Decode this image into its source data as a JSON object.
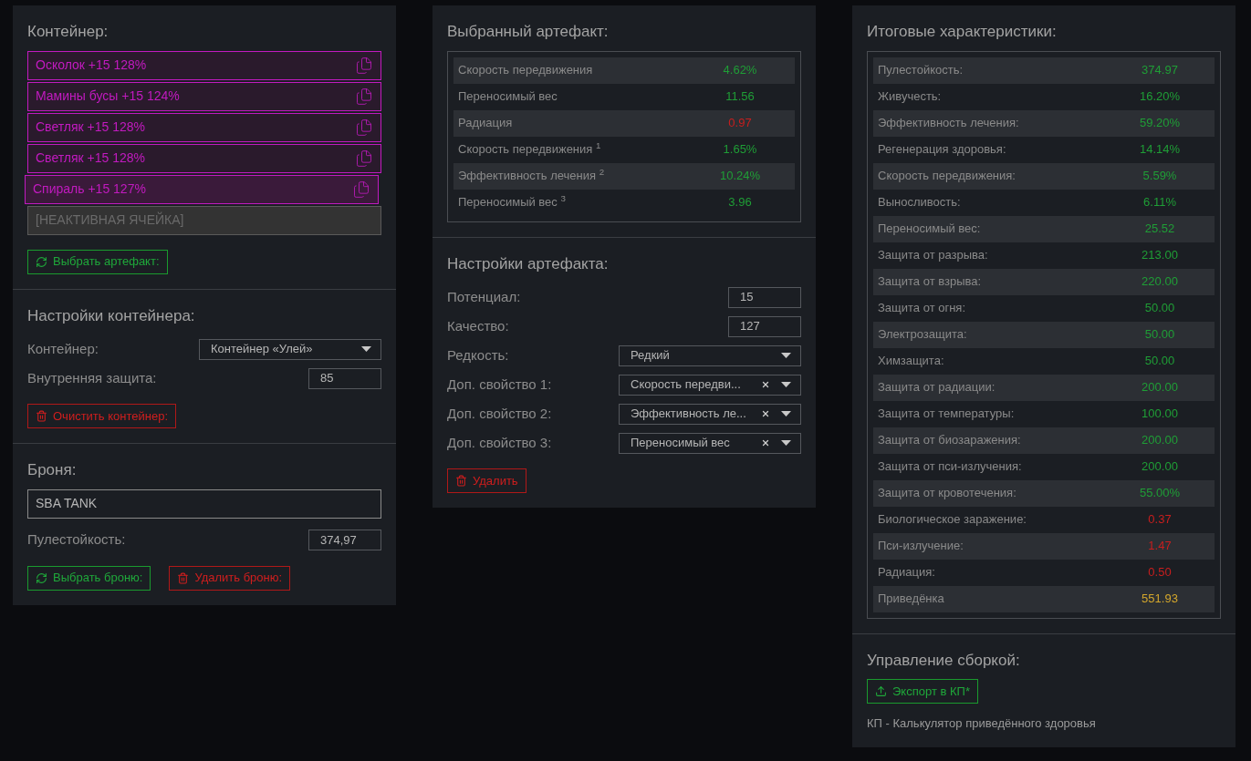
{
  "container": {
    "title": "Контейнер:",
    "slots": [
      {
        "kind": "artifact",
        "label": "Осколок +15 128%",
        "selected": false
      },
      {
        "kind": "artifact",
        "label": "Мамины бусы +15 124%",
        "selected": false
      },
      {
        "kind": "artifact",
        "label": "Светляк +15 128%",
        "selected": false
      },
      {
        "kind": "artifact",
        "label": "Светляк +15 128%",
        "selected": false
      },
      {
        "kind": "artifact",
        "label": "Спираль +15 127%",
        "selected": true
      },
      {
        "kind": "inactive",
        "label": "[НЕАКТИВНАЯ ЯЧЕЙКА]",
        "selected": false
      }
    ],
    "buttons": [
      {
        "kind": "pick",
        "label": "Выбрать артефакт:"
      }
    ]
  },
  "container_settings": {
    "title": "Настройки контейнера:",
    "fields": [
      {
        "kind": "select",
        "label": "Контейнер:",
        "value": "Контейнер «Улей»",
        "clearable": false
      },
      {
        "kind": "number",
        "label": "Внутренняя защита:",
        "value": "85"
      }
    ],
    "buttons": [
      {
        "kind": "delete",
        "label": "Очистить контейнер:"
      }
    ]
  },
  "armor": {
    "title": "Броня:",
    "name_field": {
      "value": "SBA TANK"
    },
    "fields": [
      {
        "kind": "number",
        "label": "Пулестойкость:",
        "value": "374,97"
      }
    ],
    "buttons": [
      {
        "kind": "pick",
        "label": "Выбрать броню:"
      },
      {
        "kind": "delete",
        "label": "Удалить броню:"
      }
    ]
  },
  "selected_artifact": {
    "title": "Выбранный артефакт:",
    "stats": [
      {
        "label": "Скорость передвижения",
        "value": "4.62%",
        "color": "#1f9e36"
      },
      {
        "label": "Переносимый вес",
        "value": "11.56",
        "color": "#1f9e36"
      },
      {
        "label": "Радиация",
        "value": "0.97",
        "color": "#c81e1e"
      },
      {
        "label": "Скорость передвижения $^{1}$",
        "value": "1.65%",
        "color": "#1f9e36"
      },
      {
        "label": "Эффективность лечения $^{2}$",
        "value": "10.24%",
        "color": "#1f9e36"
      },
      {
        "label": "Переносимый вес $^{3}$",
        "value": "3.96",
        "color": "#1f9e36"
      }
    ]
  },
  "artifact_settings": {
    "title": "Настройки артефакта:",
    "fields": [
      {
        "kind": "number",
        "label": "Потенциал:",
        "value": "15"
      },
      {
        "kind": "number",
        "label": "Качество:",
        "value": "127"
      },
      {
        "kind": "select",
        "label": "Редкость:",
        "value": "Редкий",
        "clearable": false
      },
      {
        "kind": "select",
        "label": "Доп. свойство 1:",
        "value": "Скорость передви...",
        "clearable": true
      },
      {
        "kind": "select",
        "label": "Доп. свойство 2:",
        "value": "Эффективность ле...",
        "clearable": true
      },
      {
        "kind": "select",
        "label": "Доп. свойство 3:",
        "value": "Переносимый вес",
        "clearable": true
      }
    ],
    "buttons": [
      {
        "kind": "delete",
        "label": "Удалить"
      }
    ]
  },
  "totals": {
    "title": "Итоговые характеристики:",
    "stats": [
      {
        "label": "Пулестойкость:",
        "value": "374.97",
        "color": "#1f9e36"
      },
      {
        "label": "Живучесть:",
        "value": "16.20%",
        "color": "#1f9e36"
      },
      {
        "label": "Эффективность лечения:",
        "value": "59.20%",
        "color": "#1f9e36"
      },
      {
        "label": "Регенерация здоровья:",
        "value": "14.14%",
        "color": "#1f9e36"
      },
      {
        "label": "Скорость передвижения:",
        "value": "5.59%",
        "color": "#1f9e36"
      },
      {
        "label": "Выносливость:",
        "value": "6.11%",
        "color": "#1f9e36"
      },
      {
        "label": "Переносимый вес:",
        "value": "25.52",
        "color": "#1f9e36"
      },
      {
        "label": "Защита от разрыва:",
        "value": "213.00",
        "color": "#1f9e36"
      },
      {
        "label": "Защита от взрыва:",
        "value": "220.00",
        "color": "#1f9e36"
      },
      {
        "label": "Защита от огня:",
        "value": "50.00",
        "color": "#1f9e36"
      },
      {
        "label": "Электрозащита:",
        "value": "50.00",
        "color": "#1f9e36"
      },
      {
        "label": "Химзащита:",
        "value": "50.00",
        "color": "#1f9e36"
      },
      {
        "label": "Защита от радиации:",
        "value": "200.00",
        "color": "#1f9e36"
      },
      {
        "label": "Защита от температуры:",
        "value": "100.00",
        "color": "#1f9e36"
      },
      {
        "label": "Защита от биозаражения:",
        "value": "200.00",
        "color": "#1f9e36"
      },
      {
        "label": "Защита от пси-излучения:",
        "value": "200.00",
        "color": "#1f9e36"
      },
      {
        "label": "Защита от кровотечения:",
        "value": "55.00%",
        "color": "#1f9e36"
      },
      {
        "label": "Биологическое заражение:",
        "value": "0.37",
        "color": "#c81e1e"
      },
      {
        "label": "Пси-излучение:",
        "value": "1.47",
        "color": "#c81e1e"
      },
      {
        "label": "Радиация:",
        "value": "0.50",
        "color": "#c81e1e"
      },
      {
        "label": "Приведёнка",
        "value": "551.93",
        "color": "#d4a72c"
      }
    ]
  },
  "build_management": {
    "title": "Управление сборкой:",
    "buttons": [
      {
        "kind": "export",
        "label": "Экспорт в КП*"
      }
    ],
    "note": "КП - Калькулятор приведённого здоровья"
  }
}
